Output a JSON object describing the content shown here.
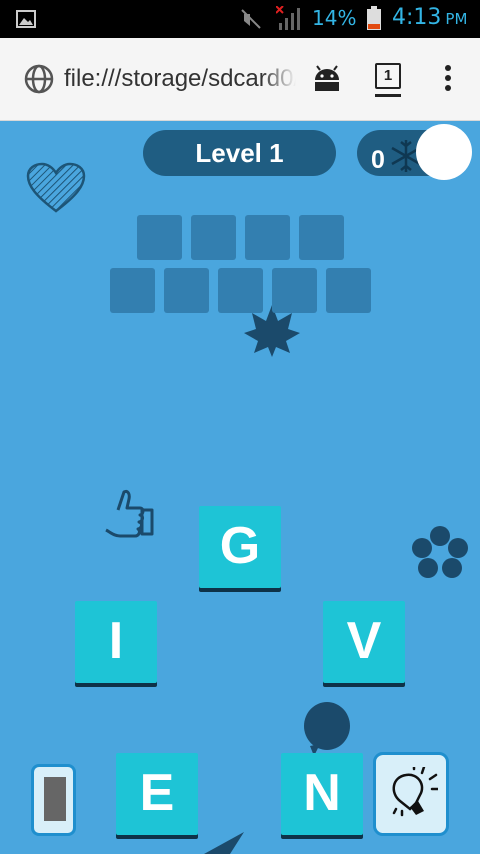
{
  "status_bar": {
    "battery_percent": "14%",
    "time": "4:13",
    "ampm": "PM",
    "icons": [
      "image-icon",
      "mute-icon",
      "signal-icon",
      "battery-icon"
    ]
  },
  "browser": {
    "url": "file:///storage/sdcard0/",
    "tab_count": "1",
    "icons": [
      "globe-icon",
      "android-icon",
      "tabs-icon",
      "overflow-menu-icon"
    ]
  },
  "game": {
    "level_label": "Level 1",
    "score": "0",
    "answer_slots": {
      "row1": 4,
      "row2": 5
    },
    "letter_tiles": [
      {
        "letter": "G"
      },
      {
        "letter": "I"
      },
      {
        "letter": "V"
      },
      {
        "letter": "E"
      },
      {
        "letter": "N"
      }
    ],
    "decorations": [
      "heart-icon",
      "leaf-icon",
      "thumbs-up-icon",
      "flower-icon",
      "balloon-icon"
    ],
    "buttons": [
      "shuffle-button",
      "hint-lightbulb-button"
    ]
  },
  "colors": {
    "background": "#4aa6de",
    "pill": "#1f5d82",
    "slot": "#337fb0",
    "tile": "#1ec4d6",
    "status_text": "#33b5e5"
  }
}
